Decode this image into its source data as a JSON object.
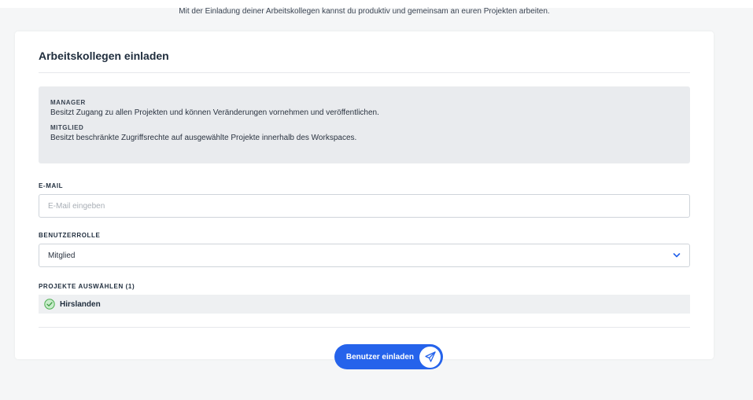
{
  "intro_text": "Mit der Einladung deiner Arbeitskollegen kannst du produktiv und gemeinsam an euren Projekten arbeiten.",
  "card": {
    "title": "Arbeitskollegen einladen"
  },
  "roles_info": [
    {
      "title": "MANAGER",
      "description": "Besitzt Zugang zu allen Projekten und können Veränderungen vornehmen und veröffentlichen."
    },
    {
      "title": "MITGLIED",
      "description": "Besitzt beschränkte Zugriffsrechte auf ausgewählte Projekte innerhalb des Workspaces."
    }
  ],
  "email": {
    "label": "E-MAIL",
    "value": "",
    "placeholder": "E-Mail eingeben"
  },
  "role_select": {
    "label": "BENUTZERROLLE",
    "selected": "Mitglied",
    "icon": "chevron-down-icon"
  },
  "projects": {
    "label": "PROJEKTE AUSWÄHLEN (1)",
    "items": [
      {
        "name": "Hirslanden",
        "selected": true,
        "icon": "check-circle-icon"
      }
    ]
  },
  "invite_button": {
    "label": "Benutzer einladen",
    "icon": "paper-plane-icon"
  },
  "colors": {
    "accent": "#2563eb",
    "check": "#4caf50",
    "check_fill": "#c8eccb",
    "info_bg": "#e9ebee"
  }
}
